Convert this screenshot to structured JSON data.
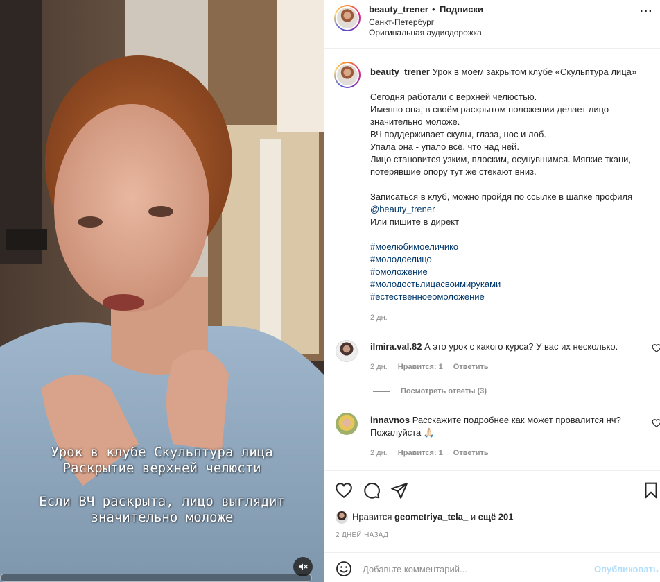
{
  "header": {
    "username": "beauty_trener",
    "dot": "•",
    "follow": "Подписки",
    "location": "Санкт-Петербург",
    "audio": "Оригинальная аудиодорожка",
    "more": "···"
  },
  "video": {
    "caption_line1": "Урок в клубе Скульптура лица",
    "caption_line2": "Раскрытие верхней челюсти",
    "caption_line3": "Если ВЧ раскрыта, лицо выглядит",
    "caption_line4": "значительно моложе",
    "mute_icon": "speaker-muted-icon"
  },
  "post": {
    "username": "beauty_trener",
    "title": "Урок в моём закрытом клубе «Скульптура лица»",
    "lines": [
      "Сегодня работали с верхней челюстью.",
      "Именно она, в своём раскрытом положении делает лицо",
      "значительно моложе.",
      "ВЧ поддерживает скулы, глаза, нос и лоб.",
      "Упала она - упало всё, что над ней.",
      "Лицо становится узким, плоским, осунувшимся. Мягкие ткани,",
      "потерявшие опору тут же стекают вниз."
    ],
    "signup_line": "Записаться в клуб, можно пройдя по ссылке в шапке профиля",
    "mention": "@beauty_trener",
    "direct_line": "Или пишите в директ",
    "hashtags": [
      "#моелюбимоеличико",
      "#молодоелицо",
      "#омоложение",
      "#молодостьлицасвоимируками",
      "#естественноеомоложение"
    ],
    "time": "2 дн."
  },
  "comments": [
    {
      "username": "ilmira.val.82",
      "text": "А это урок с какого курса? У вас их несколько.",
      "time": "2 дн.",
      "likes": "Нравится: 1",
      "reply": "Ответить",
      "view_replies": "Посмотреть ответы (3)"
    },
    {
      "username": "innavnos",
      "text": "Расскажите подробнее как может провалится нч?",
      "text2": "Пожалуйста 🙏🏻",
      "time": "2 дн.",
      "likes": "Нравится: 1",
      "reply": "Ответить"
    }
  ],
  "likes": {
    "prefix": "Нравится",
    "user": "geometriya_tela_",
    "and": "и",
    "rest": "ещё 201"
  },
  "posted_ago": "2 ДНЕЙ НАЗАД",
  "add_comment": {
    "placeholder": "Добавьте комментарий...",
    "publish": "Опубликовать"
  },
  "colors": {
    "link": "#00376b",
    "muted": "#8e8e8e",
    "publish_disabled": "#b2dffc"
  }
}
